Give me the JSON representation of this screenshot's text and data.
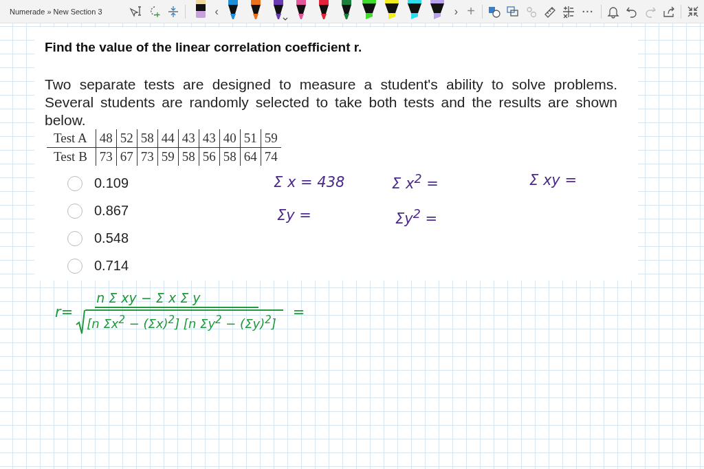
{
  "breadcrumb": "Numerade » New Section 3",
  "toolbar": {
    "prev": "‹",
    "next": "›",
    "add": "+",
    "more": "···"
  },
  "pens": [
    {
      "kind": "pencil",
      "color": "#c9a0dc",
      "selected": false
    },
    {
      "kind": "pen",
      "color": "#1e8fd6",
      "selected": false
    },
    {
      "kind": "pen",
      "color": "#e8731c",
      "selected": false
    },
    {
      "kind": "pen",
      "color": "#6a3cb4",
      "selected": true
    },
    {
      "kind": "pen",
      "color": "#e2579a",
      "selected": false
    },
    {
      "kind": "pen",
      "color": "#e2243b",
      "selected": false
    },
    {
      "kind": "pen",
      "color": "#1a7f3c",
      "selected": false
    },
    {
      "kind": "highlighter",
      "color": "#3fdc2c",
      "selected": false
    },
    {
      "kind": "highlighter",
      "color": "#f2ec1c",
      "selected": false
    },
    {
      "kind": "highlighter",
      "color": "#2fdcec",
      "selected": false
    },
    {
      "kind": "highlighter",
      "color": "#b9a2ec",
      "selected": false
    }
  ],
  "question": {
    "title": "Find the value of the linear correlation coefficient r.",
    "text": "Two separate tests are designed to measure a student's ability to solve problems. Several students are randomly selected to take both tests and the results are shown below.",
    "table": [
      [
        "Test A",
        "48",
        "52",
        "58",
        "44",
        "43",
        "43",
        "40",
        "51",
        "59"
      ],
      [
        "Test B",
        "73",
        "67",
        "73",
        "59",
        "58",
        "56",
        "58",
        "64",
        "74"
      ]
    ],
    "options": [
      {
        "label": "0.109",
        "selected": false
      },
      {
        "label": "0.867",
        "selected": false
      },
      {
        "label": "0.548",
        "selected": false
      },
      {
        "label": "0.714",
        "selected": false
      }
    ]
  },
  "ink": [
    {
      "kind": "note",
      "color": "#4b2a8c",
      "text": "Σ x = 438"
    },
    {
      "kind": "note",
      "color": "#4b2a8c",
      "text": "Σ x$^{2}$ ="
    },
    {
      "kind": "note",
      "color": "#4b2a8c",
      "text": "Σ xy ="
    },
    {
      "kind": "note",
      "color": "#4b2a8c",
      "text": "Σy ="
    },
    {
      "kind": "note",
      "color": "#4b2a8c",
      "text": "Σy$^{2}$ ="
    },
    {
      "kind": "formula",
      "color": "#1e9a3a",
      "lhs": "r=",
      "numerator": "n Σ xy  −  Σ x Σ y",
      "denominator": "[n Σx$^{2}$ − (Σx)$^{2}$] [n Σy$^{2}$ − (Σy)$^{2}$]",
      "rhs": "="
    }
  ]
}
